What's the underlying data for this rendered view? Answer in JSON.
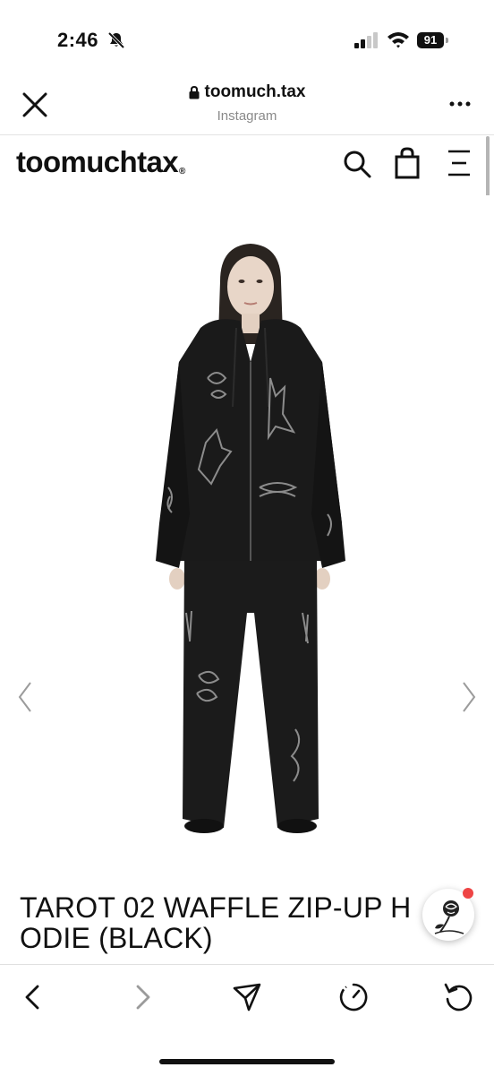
{
  "status_bar": {
    "time": "2:46",
    "battery_level": "91",
    "icons": [
      "bell-slash-icon",
      "signal-icon",
      "wifi-icon",
      "battery-icon"
    ]
  },
  "browser": {
    "domain": "toomuch.tax",
    "source": "Instagram",
    "icons": [
      "close-icon",
      "lock-icon",
      "more-icon"
    ]
  },
  "site": {
    "logo": "toomuchtax",
    "logo_mark": "®",
    "icons": [
      "search-icon",
      "shopping-bag-icon",
      "menu-icon"
    ]
  },
  "product": {
    "title": "TAROT 02 WAFFLE ZIP-UP HOODIE (BLACK)",
    "title_line1": "TAROT 02 WAFFLE ZIP-UP H",
    "title_line2": "ODIE (BLACK)",
    "carousel_icons": [
      "chevron-left-icon",
      "chevron-right-icon"
    ],
    "garment_color": "#1a1a1a",
    "print_color": "#8c8c8c"
  },
  "toolbar": {
    "icons": [
      "back-icon",
      "forward-icon",
      "share-icon",
      "timer-icon",
      "reload-icon"
    ]
  },
  "colors": {
    "text": "#111111",
    "muted": "#8a8a8a",
    "badge": "#ee4444",
    "divider": "#e3e3e3"
  }
}
